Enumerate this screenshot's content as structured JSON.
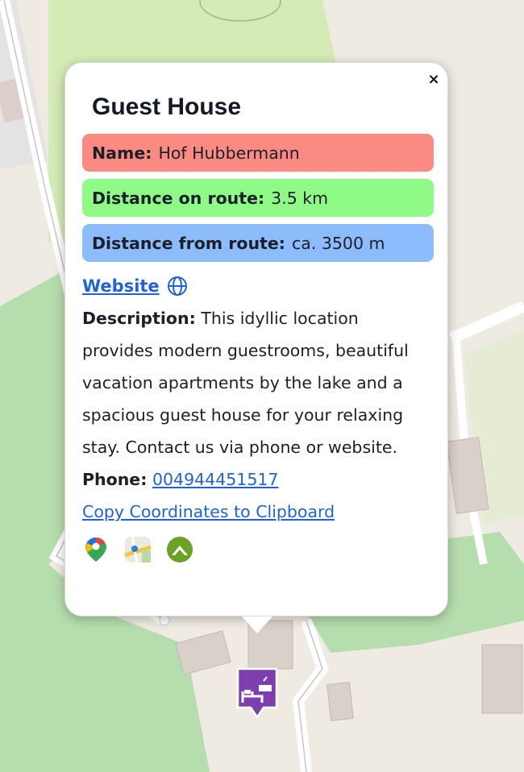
{
  "popup": {
    "title": "Guest House",
    "close_label": "×",
    "name_label": "Name:",
    "name_value": "Hof Hubbermann",
    "distance_on_route_label": "Distance on route:",
    "distance_on_route_value": "3.5 km",
    "distance_from_route_label": "Distance from route:",
    "distance_from_route_value": "ca. 3500 m",
    "website_label": "Website",
    "description_label": "Description:",
    "description_text": "This idyllic location provides modern guestrooms, beautiful vacation apartments by the lake and a spacious guest house for your relaxing stay. Contact us via phone or website.",
    "phone_label": "Phone:",
    "phone_value": "004944451517",
    "copy_coordinates_label": "Copy Coordinates to Clipboard",
    "apps": [
      "google-maps-icon",
      "apple-maps-icon",
      "komoot-icon"
    ]
  },
  "colors": {
    "name_badge": "#fb8a83",
    "distance_on_route_badge": "#8ffb86",
    "distance_from_route_badge": "#8dbcfc",
    "link": "#1f62d9",
    "marker": "#7d3fae"
  },
  "map": {
    "marker_icon": "guest-house-icon"
  }
}
